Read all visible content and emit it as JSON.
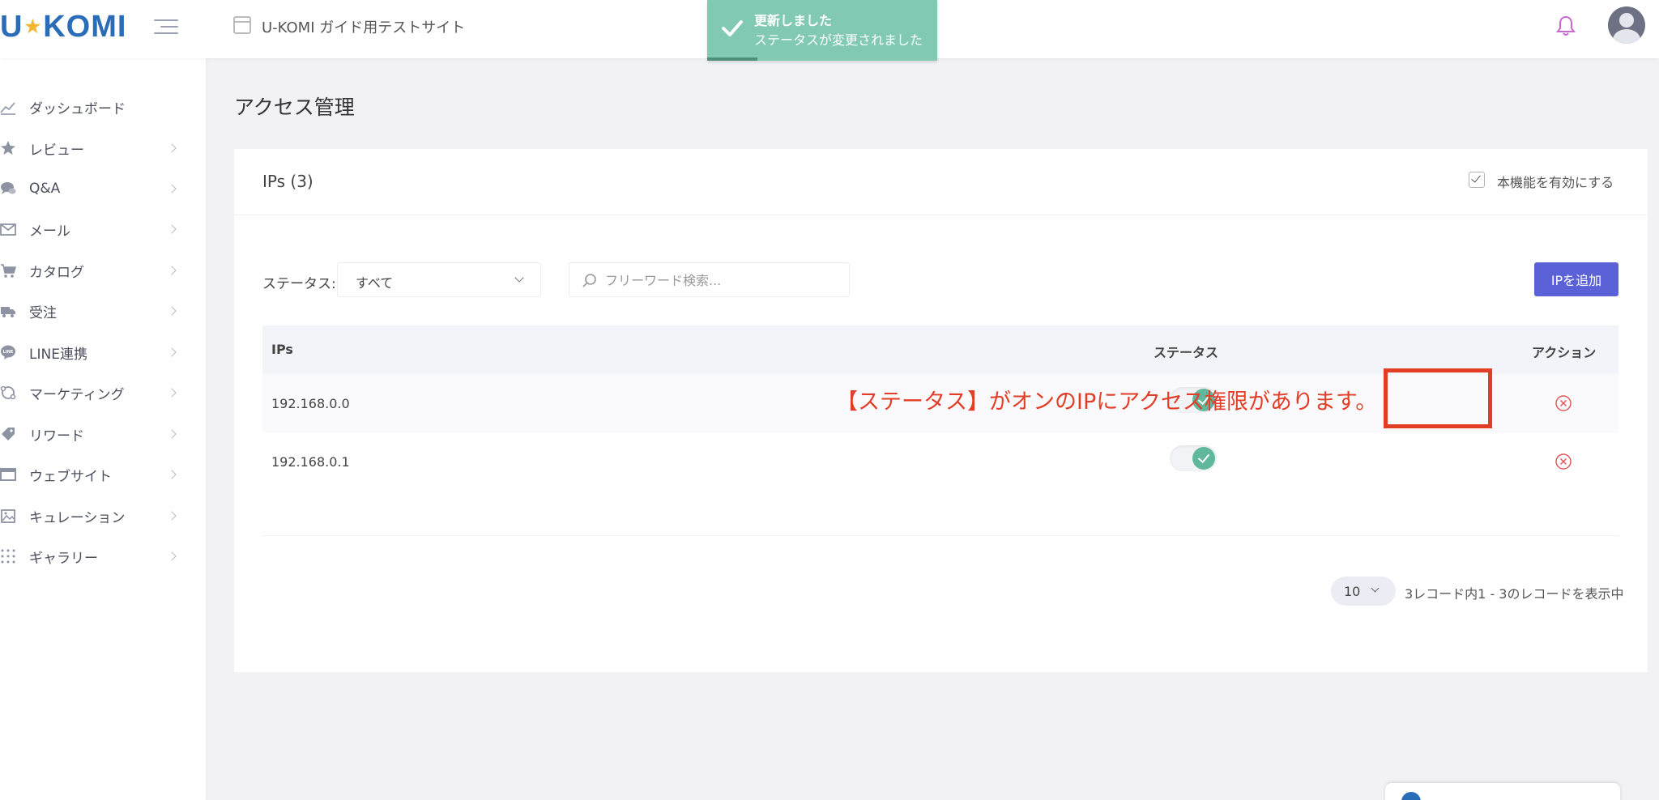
{
  "header": {
    "logo": {
      "left": "U",
      "right": "KOMI"
    },
    "site_title": "U-KOMI ガイド用テストサイト"
  },
  "toast": {
    "title": "更新しました",
    "message": "ステータスが変更されました"
  },
  "sidebar": {
    "items": [
      {
        "label": "ダッシュボード",
        "icon": "dashboard-icon",
        "has_chevron": false
      },
      {
        "label": "レビュー",
        "icon": "star-icon",
        "has_chevron": true
      },
      {
        "label": "Q&A",
        "icon": "chat-icon",
        "has_chevron": true
      },
      {
        "label": "メール",
        "icon": "mail-icon",
        "has_chevron": true
      },
      {
        "label": "カタログ",
        "icon": "cart-icon",
        "has_chevron": true
      },
      {
        "label": "受注",
        "icon": "truck-icon",
        "has_chevron": true
      },
      {
        "label": "LINE連携",
        "icon": "line-icon",
        "has_chevron": true
      },
      {
        "label": "マーケティング",
        "icon": "marketing-icon",
        "has_chevron": true
      },
      {
        "label": "リワード",
        "icon": "tag-icon",
        "has_chevron": true
      },
      {
        "label": "ウェブサイト",
        "icon": "website-icon",
        "has_chevron": true
      },
      {
        "label": "キュレーション",
        "icon": "image-icon",
        "has_chevron": true
      },
      {
        "label": "ギャラリー",
        "icon": "grid-icon",
        "has_chevron": true
      }
    ]
  },
  "page": {
    "title": "アクセス管理"
  },
  "card": {
    "title": "IPs (3)",
    "enable_label": "本機能を有効にする",
    "enable_checked": true
  },
  "filter": {
    "status_label": "ステータス:",
    "status_value": "すべて",
    "search_placeholder": "フリーワード検索...",
    "add_button": "IPを追加"
  },
  "table": {
    "headers": {
      "ip": "IPs",
      "status": "ステータス",
      "action": "アクション"
    },
    "rows": [
      {
        "ip": "192.168.0.0",
        "status_on": true
      },
      {
        "ip": "192.168.0.1",
        "status_on": true
      }
    ]
  },
  "annotation": {
    "text": "【ステータス】がオンのIPにアクセス権限があります。",
    "color": "#e23d27"
  },
  "pagination": {
    "per_page": "10",
    "records_text": "3レコード内1 - 3のレコードを表示中"
  },
  "colors": {
    "accent": "#5b61d6",
    "toast_bg": "#81c9b2",
    "toggle_on": "#5fb89b",
    "delete": "#e05a5a",
    "logo": "#2b6cb8"
  }
}
